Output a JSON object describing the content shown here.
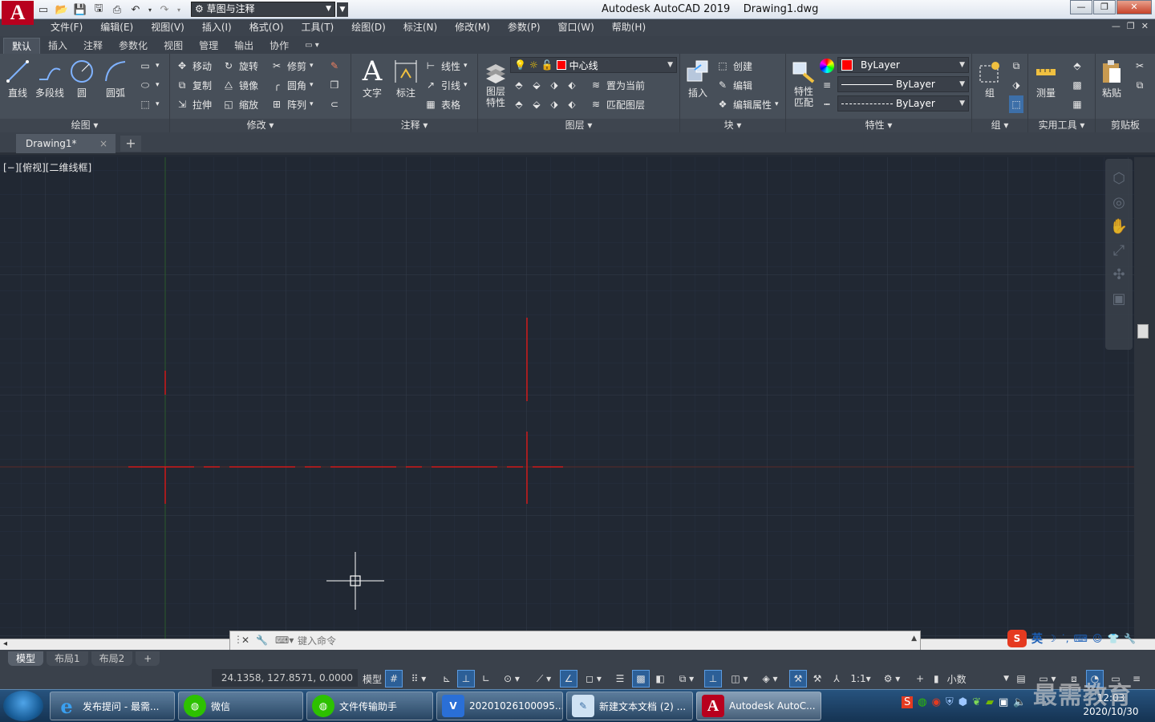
{
  "titlebar": {
    "logo": "A",
    "workspace": "草图与注释",
    "app_title": "Autodesk AutoCAD 2019    Drawing1.dwg"
  },
  "menubar": [
    "文件(F)",
    "编辑(E)",
    "视图(V)",
    "插入(I)",
    "格式(O)",
    "工具(T)",
    "绘图(D)",
    "标注(N)",
    "修改(M)",
    "参数(P)",
    "窗口(W)",
    "帮助(H)"
  ],
  "ribbon_tabs": [
    "默认",
    "插入",
    "注释",
    "参数化",
    "视图",
    "管理",
    "输出",
    "协作"
  ],
  "ribbon": {
    "draw": {
      "title": "绘图",
      "line": "直线",
      "polyline": "多段线",
      "circle": "圆",
      "arc": "圆弧"
    },
    "modify": {
      "title": "修改",
      "move": "移动",
      "rotate": "旋转",
      "trim": "修剪",
      "copy": "复制",
      "mirror": "镜像",
      "fillet": "圆角",
      "stretch": "拉伸",
      "scale": "缩放",
      "array": "阵列"
    },
    "annotation": {
      "title": "注释",
      "text": "文字",
      "dimension": "标注",
      "linear": "线性",
      "leader": "引线",
      "table": "表格"
    },
    "layers": {
      "title": "图层",
      "properties_line1": "图层",
      "properties_line2": "特性",
      "current_layer": "中心线",
      "set_current": "置为当前",
      "match_layer": "匹配图层"
    },
    "block": {
      "title": "块",
      "insert": "插入",
      "create": "创建",
      "edit": "编辑",
      "edit_attr": "编辑属性"
    },
    "properties": {
      "title": "特性",
      "match_line1": "特性",
      "match_line2": "匹配",
      "color": "ByLayer",
      "lineweight": "ByLayer",
      "linetype": "ByLayer"
    },
    "groups": {
      "title": "组",
      "group": "组"
    },
    "utilities": {
      "title": "实用工具",
      "measure": "测量"
    },
    "clipboard": {
      "title": "剪贴板",
      "paste": "粘贴"
    }
  },
  "file_tabs": {
    "doc": "Drawing1*",
    "close": "×",
    "new": "+"
  },
  "viewport": {
    "label": "[−][俯视][二维线框]"
  },
  "command_line": {
    "placeholder": "键入命令"
  },
  "layout_tabs": [
    "模型",
    "布局1",
    "布局2"
  ],
  "status": {
    "coords": "24.1358, 127.8571, 0.0000",
    "model": "模型",
    "scale": "1:1",
    "units": "小数"
  },
  "taskbar": {
    "items": [
      "发布提问 - 最需...",
      "微信",
      "文件传输助手",
      "20201026100095...",
      "新建文本文档 (2) ...",
      "Autodesk AutoC..."
    ],
    "clock_time": "12:03",
    "clock_date": "2020/10/30",
    "ime": "英"
  },
  "watermark": "最需教育",
  "colors": {
    "canvas": "#212833",
    "centerline": "#d01818",
    "accent": "#2c5f97"
  }
}
